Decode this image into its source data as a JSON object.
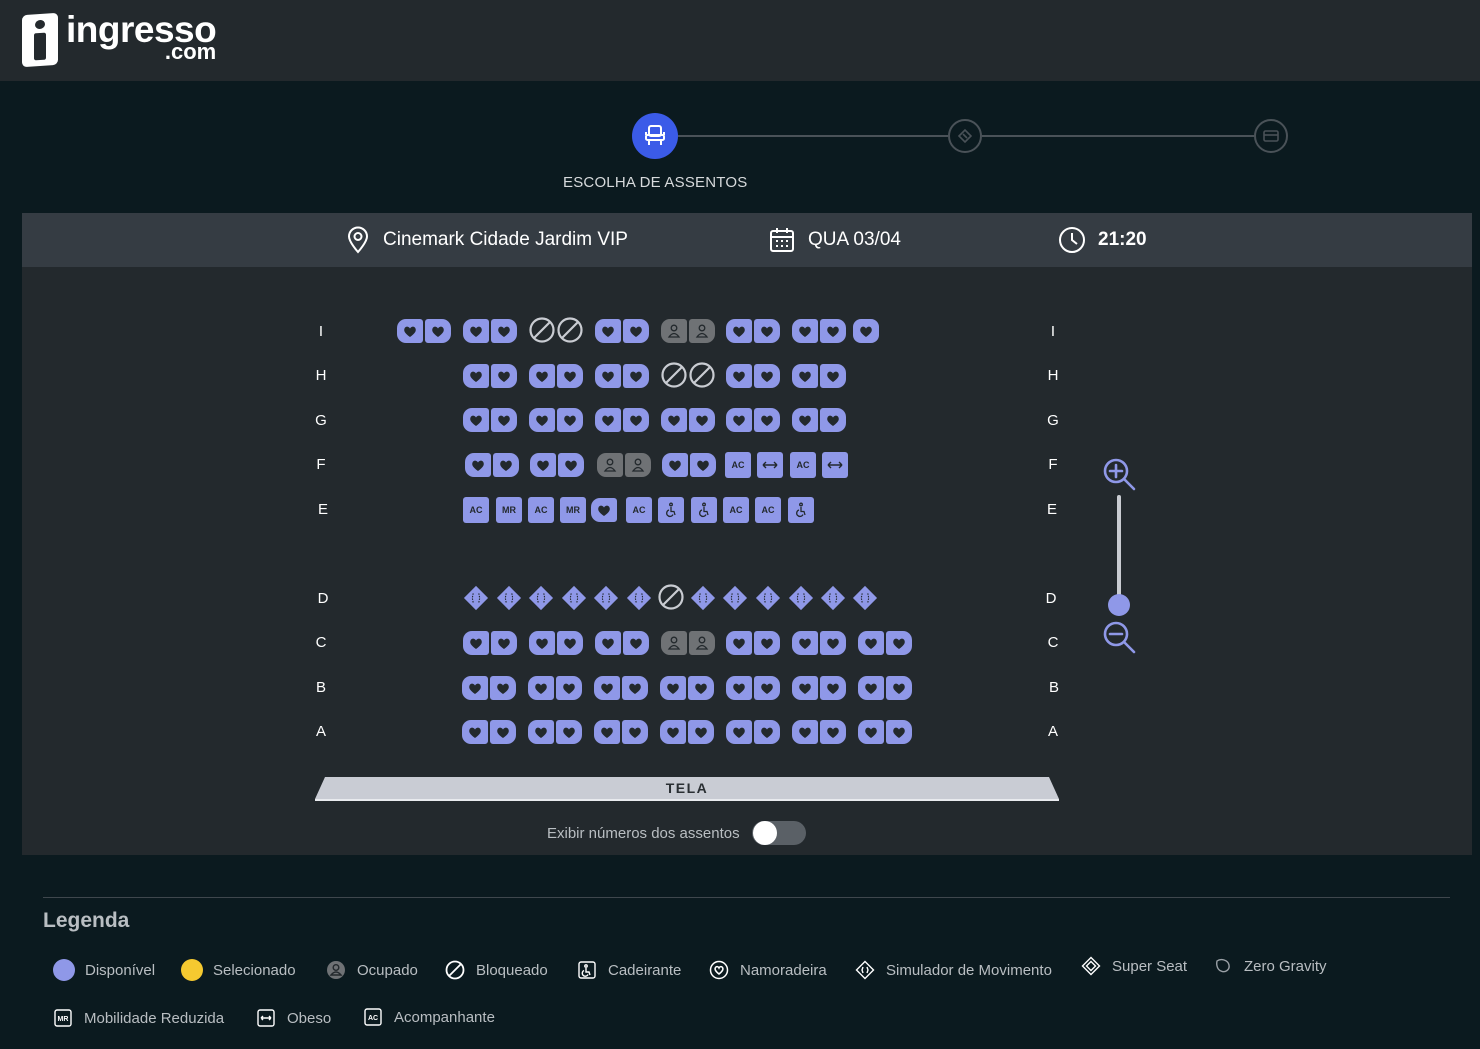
{
  "brand": {
    "name": "ingresso",
    "domain": ".com"
  },
  "stepper": {
    "steps": [
      {
        "icon": "seat-icon",
        "active": true
      },
      {
        "icon": "ticket-icon",
        "active": false
      },
      {
        "icon": "card-icon",
        "active": false
      }
    ],
    "current_label": "ESCOLHA DE ASSENTOS"
  },
  "session": {
    "cinema": "Cinemark Cidade Jardim VIP",
    "date": "QUA 03/04",
    "time": "21:20"
  },
  "rows": {
    "top": [
      "I",
      "H",
      "G",
      "F",
      "E"
    ],
    "bottom": [
      "D",
      "C",
      "B",
      "A"
    ]
  },
  "seat_codes": {
    "ac": "AC",
    "mr": "MR"
  },
  "screen_label": "TELA",
  "seat_numbers_toggle": {
    "label": "Exibir números dos assentos",
    "on": false
  },
  "colors": {
    "available": "#8f98e8",
    "selected": "#f5c930",
    "occupied": "#6f7275",
    "accent": "#3b5be8"
  },
  "legend": {
    "title": "Legenda",
    "items": [
      {
        "label": "Disponível",
        "icon": "available-dot"
      },
      {
        "label": "Selecionado",
        "icon": "selected-dot"
      },
      {
        "label": "Ocupado",
        "icon": "occupied-icon"
      },
      {
        "label": "Bloqueado",
        "icon": "blocked-icon"
      },
      {
        "label": "Cadeirante",
        "icon": "wheelchair-icon"
      },
      {
        "label": "Namoradeira",
        "icon": "heart-icon"
      },
      {
        "label": "Simulador de Movimento",
        "icon": "motion-simulator-icon"
      },
      {
        "label": "Super Seat",
        "icon": "super-seat-icon"
      },
      {
        "label": "Zero Gravity",
        "icon": "zero-gravity-icon"
      },
      {
        "label": "Mobilidade Reduzida",
        "icon": "reduced-mobility-icon"
      },
      {
        "label": "Obeso",
        "icon": "obese-icon"
      },
      {
        "label": "Acompanhante",
        "icon": "companion-icon"
      }
    ]
  }
}
